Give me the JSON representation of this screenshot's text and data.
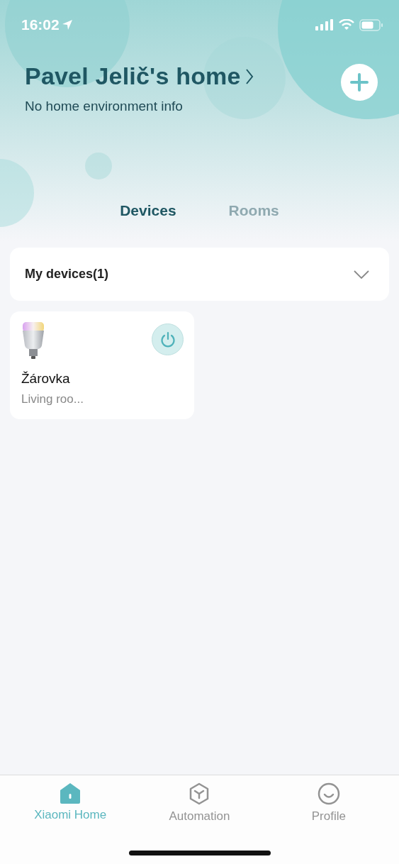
{
  "status_bar": {
    "time": "16:02"
  },
  "header": {
    "title": "Pavel Jelič's home",
    "subtitle": "No home environment info"
  },
  "tabs": [
    {
      "label": "Devices",
      "selected": true
    },
    {
      "label": "Rooms",
      "selected": false
    }
  ],
  "section": {
    "title": "My devices(1)"
  },
  "devices": [
    {
      "name": "Žárovka",
      "room": "Living roo...",
      "on": true
    }
  ],
  "nav": [
    {
      "label": "Xiaomi Home",
      "kind": "home",
      "selected": true
    },
    {
      "label": "Automation",
      "kind": "automation",
      "selected": false
    },
    {
      "label": "Profile",
      "kind": "profile",
      "selected": false
    }
  ]
}
